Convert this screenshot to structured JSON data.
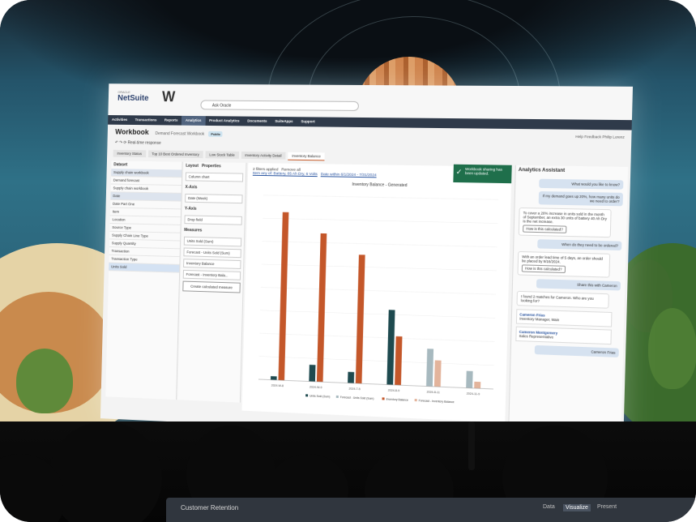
{
  "app": {
    "brand": "NetSuite",
    "brand_small": "ORACLE",
    "ask_placeholder": "Ask Oracle"
  },
  "nav": {
    "items": [
      "Activities",
      "Transactions",
      "Reports",
      "Analytics",
      "Product Analytics",
      "Documents",
      "SuiteApps",
      "Support"
    ],
    "active": "Analytics"
  },
  "workbook": {
    "title": "Workbook",
    "subtitle": "Demand Forecast Workbook",
    "badge": "Public",
    "right": "Help   Feedback   Philip Lorenz",
    "toolbar": "Real-time response"
  },
  "tabs": [
    "Inventory Status",
    "Top 10 Best Ordered Inventory",
    "Low Stock Table",
    "Inventory Activity Detail",
    "Inventory Balance"
  ],
  "active_tab": "Inventory Balance",
  "dataset": {
    "title": "Dataset",
    "link": "Supply chain workbook",
    "group": "Demand forecast",
    "fields": [
      "Supply chain workbook",
      "Date",
      "Date Part One",
      "Item",
      "Location",
      "Source Type",
      "Supply Chain Line Type",
      "Supply Quantity",
      "Transaction",
      "Transaction Type",
      "Units Sold"
    ],
    "selected": "Date",
    "highlighted": "Units Sold"
  },
  "layout": {
    "tab1": "Layout",
    "tab2": "Properties",
    "chart_type": "Column chart",
    "xaxis": "X-Axis",
    "x_field": "Date (Week)",
    "yaxis": "Y-Axis",
    "drop": "Drop field",
    "measures_label": "Measures",
    "measures": [
      "Units Sold (Sum)",
      "Forecast - Units Sold (Sum)",
      "Inventory Balance",
      "Forecast - Inventory Bala..."
    ],
    "create_btn": "Create calculated measure"
  },
  "filters": {
    "applied": "2 filters applied",
    "remove": "Remove all",
    "f1": "Item any of: Battery, 85 Ah Dry, 6 Volts",
    "f2": "Date within 6/1/2024 - 7/31/2024"
  },
  "toast": {
    "text": "Workbook sharing has been updated."
  },
  "assistant": {
    "title": "Analytics Assistant",
    "messages": [
      {
        "role": "user",
        "text": "What would you like to know?"
      },
      {
        "role": "user",
        "text": "If my demand goes up 20%, how many units do we need to order?"
      },
      {
        "role": "bot",
        "text": "To cover a 20% increase in units sold in the month of September, an extra 30 units of battery 40 Ah Dry is the net increase.",
        "action": "How is this calculated?"
      },
      {
        "role": "user",
        "text": "When do they need to be ordered?"
      },
      {
        "role": "bot",
        "text": "With an order lead time of 5 days, an order should be placed by 9/16/2024.",
        "action": "How is this calculated?"
      },
      {
        "role": "user",
        "text": "Share this with Cameron"
      },
      {
        "role": "bot",
        "text": "I found 2 matches for Cameron. Who are you looking for?"
      }
    ],
    "contacts": [
      {
        "name": "Cameron Frias",
        "role": "Inventory Manager, Main"
      },
      {
        "name": "Cameron Montgomery",
        "role": "Sales Representative"
      }
    ],
    "reply": "Cameron Frias"
  },
  "laptop": {
    "title": "Customer Retention",
    "modes": [
      "Data",
      "Visualize",
      "Present"
    ],
    "active_mode": "Visualize"
  },
  "colors": {
    "units_sold": "#1e4a4f",
    "inventory_balance": "#c4572a",
    "forecast_units": "#a7b9bf",
    "forecast_inventory": "#e3b49c",
    "nav": "#2f3a4a"
  },
  "chart_data": {
    "type": "bar",
    "title": "Inventory Balance - Generated",
    "categories": [
      "2024-W-8",
      "2024-W-9",
      "2024-7-5",
      "2024-8-9",
      "2024-8-11",
      "2024-11-9"
    ],
    "series": [
      {
        "name": "Units Sold (Sum)",
        "values": [
          4,
          18,
          12,
          80,
          0,
          0
        ]
      },
      {
        "name": "Forecast - Units Sold (Sum)",
        "values": [
          0,
          0,
          0,
          0,
          40,
          18
        ]
      },
      {
        "name": "Inventory Balance",
        "values": [
          182,
          160,
          138,
          52,
          0,
          0
        ]
      },
      {
        "name": "Forecast - Inventory Balance",
        "values": [
          0,
          0,
          0,
          0,
          28,
          7
        ]
      }
    ],
    "ylim": [
      0,
      200
    ],
    "grid": true,
    "legend": "bottom"
  }
}
